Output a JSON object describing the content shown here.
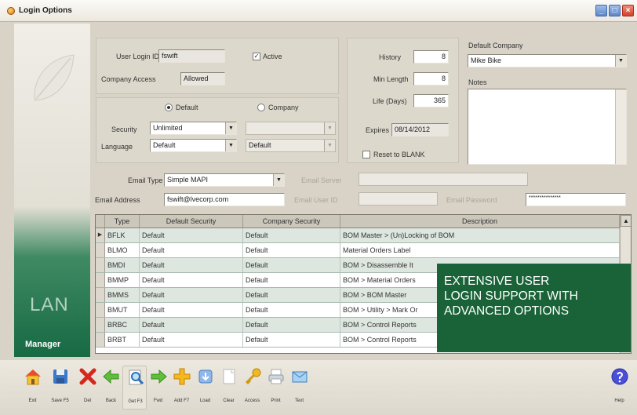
{
  "window": {
    "title": "Login Options"
  },
  "sidebar": {
    "brand_big": "LAN",
    "brand_small": "Manager"
  },
  "user": {
    "login_id_label": "User Login ID",
    "login_id": "fswift",
    "active_label": "Active",
    "active": true,
    "company_access_label": "Company Access",
    "company_access": "Allowed"
  },
  "settings": {
    "default_radio": "Default",
    "company_radio": "Company",
    "security_label": "Security",
    "security_value": "Unlimited",
    "language_label": "Language",
    "language_value": "Default",
    "company_security_value": "",
    "company_language_value": "Default"
  },
  "password": {
    "history_label": "History",
    "history": "8",
    "min_length_label": "Min Length",
    "min_length": "8",
    "life_label": "Life (Days)",
    "life": "365",
    "expires_label": "Expires",
    "expires": "08/14/2012",
    "reset_label": "Reset to BLANK"
  },
  "company": {
    "default_company_label": "Default Company",
    "default_company": "Mike Bike",
    "notes_label": "Notes"
  },
  "email": {
    "type_label": "Email Type",
    "type_value": "Simple MAPI",
    "address_label": "Email Address",
    "address_value": "fswift@lvecorp.com",
    "server_label": "Email Server",
    "user_id_label": "Email User ID",
    "password_label": "Email Password",
    "password_value": "***************"
  },
  "grid": {
    "columns": [
      "Type",
      "Default Security",
      "Company Security",
      "Description"
    ],
    "rows": [
      {
        "type": "BFLK",
        "default": "Default",
        "company": "Default",
        "desc": "BOM Master > (Un)Locking of BOM"
      },
      {
        "type": "BLMO",
        "default": "Default",
        "company": "Default",
        "desc": "Material Orders Label"
      },
      {
        "type": "BMDI",
        "default": "Default",
        "company": "Default",
        "desc": "BOM > Disassemble It"
      },
      {
        "type": "BMMP",
        "default": "Default",
        "company": "Default",
        "desc": "BOM > Material Orders"
      },
      {
        "type": "BMMS",
        "default": "Default",
        "company": "Default",
        "desc": "BOM > BOM Master"
      },
      {
        "type": "BMUT",
        "default": "Default",
        "company": "Default",
        "desc": "BOM > Utility > Mark Or"
      },
      {
        "type": "BRBC",
        "default": "Default",
        "company": "Default",
        "desc": "BOM > Control Reports"
      },
      {
        "type": "BRBT",
        "default": "Default",
        "company": "Default",
        "desc": "BOM > Control Reports"
      }
    ]
  },
  "promo": {
    "line1": "EXTENSIVE USER",
    "line2": "LOGIN SUPPORT WITH",
    "line3": "ADVANCED OPTIONS"
  },
  "toolbar": [
    {
      "label": "Exit",
      "icon": "home-icon"
    },
    {
      "label": "Save F5",
      "icon": "save-icon"
    },
    {
      "label": "Del",
      "icon": "delete-icon"
    },
    {
      "label": "Back",
      "icon": "back-arrow-icon"
    },
    {
      "label": "Get F3",
      "icon": "search-icon"
    },
    {
      "label": "Fwd",
      "icon": "forward-arrow-icon"
    },
    {
      "label": "Add F7",
      "icon": "add-icon"
    },
    {
      "label": "Load",
      "icon": "load-icon"
    },
    {
      "label": "Clear",
      "icon": "clear-icon"
    },
    {
      "label": "Access",
      "icon": "key-icon"
    },
    {
      "label": "Print",
      "icon": "printer-icon"
    },
    {
      "label": "Text",
      "icon": "email-icon"
    },
    {
      "label": "Help",
      "icon": "help-icon"
    }
  ],
  "colors": {
    "brand_green": "#176a44",
    "promo_green": "#1a6338",
    "grid_row": "#dde6df"
  }
}
